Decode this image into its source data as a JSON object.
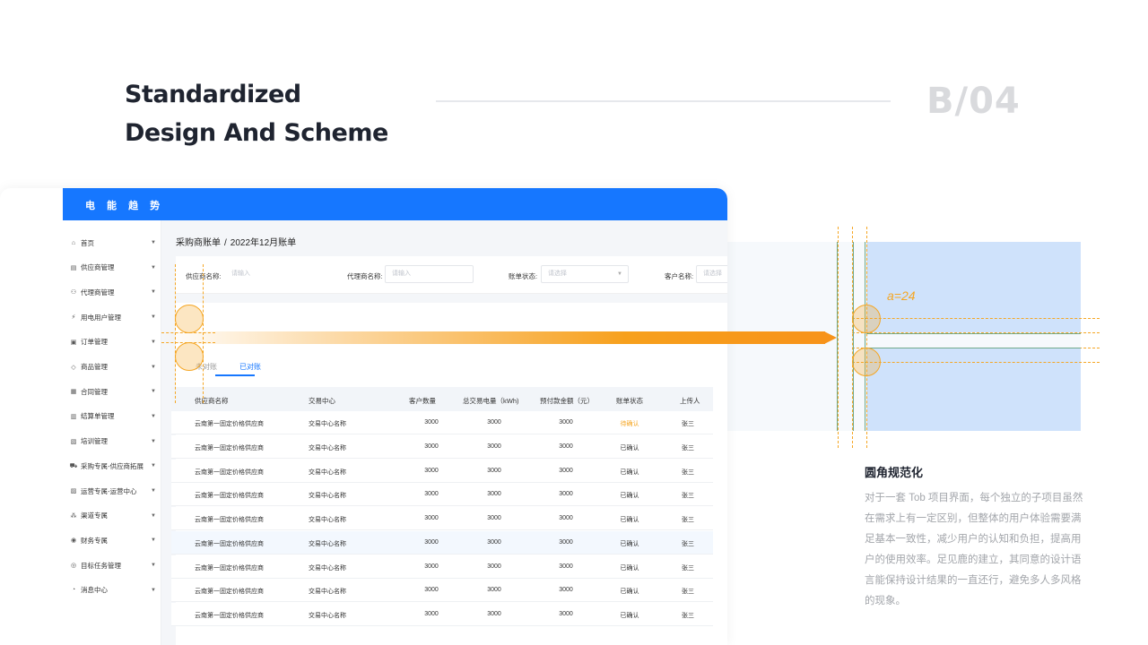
{
  "header": {
    "title_line1": "Standardized",
    "title_line2": "Design And Scheme",
    "page_code": "B/04"
  },
  "app": {
    "brand": "电 能 趋 势",
    "sidebar": {
      "items": [
        {
          "label": "首页",
          "icon": "home-icon"
        },
        {
          "label": "供应商管理",
          "icon": "building-icon"
        },
        {
          "label": "代理商管理",
          "icon": "user-icon"
        },
        {
          "label": "用电用户管理",
          "icon": "plug-icon"
        },
        {
          "label": "订单管理",
          "icon": "document-icon"
        },
        {
          "label": "商品管理",
          "icon": "tag-icon"
        },
        {
          "label": "合同管理",
          "icon": "contract-icon"
        },
        {
          "label": "结算单管理",
          "icon": "invoice-icon"
        },
        {
          "label": "培训管理",
          "icon": "training-icon"
        },
        {
          "label": "采购专属-供应商拓展",
          "icon": "cart-icon"
        },
        {
          "label": "运营专属-运营中心",
          "icon": "chart-icon"
        },
        {
          "label": "渠道专属",
          "icon": "network-icon"
        },
        {
          "label": "财务专属",
          "icon": "finance-icon"
        },
        {
          "label": "目标任务管理",
          "icon": "target-icon"
        },
        {
          "label": "消息中心",
          "icon": "bell-icon"
        }
      ]
    },
    "breadcrumb": {
      "parent": "采购商账单",
      "separator": "/",
      "current": "2022年12月账单"
    },
    "filters": {
      "supplier_label": "供应商名称:",
      "supplier_placeholder": "请输入",
      "agent_label": "代理商名称:",
      "agent_placeholder": "请输入",
      "status_label": "账单状态:",
      "status_placeholder": "请选择",
      "customer_label": "客户名称:",
      "customer_placeholder": "请选择"
    },
    "tabs": [
      {
        "label": "未对账",
        "active": false
      },
      {
        "label": "已对账",
        "active": true
      }
    ],
    "table": {
      "columns": [
        "供应商名称",
        "交易中心",
        "客户数量",
        "总交易电量（kWh)",
        "预付款金额（元）",
        "账单状态",
        "上传人"
      ],
      "rows": [
        [
          "云南第一固定价格供应商",
          "交易中心名称",
          "3000",
          "3000",
          "3000",
          "待确认",
          "张三"
        ],
        [
          "云南第一固定价格供应商",
          "交易中心名称",
          "3000",
          "3000",
          "3000",
          "已确认",
          "张三"
        ],
        [
          "云南第一固定价格供应商",
          "交易中心名称",
          "3000",
          "3000",
          "3000",
          "已确认",
          "张三"
        ],
        [
          "云南第一固定价格供应商",
          "交易中心名称",
          "3000",
          "3000",
          "3000",
          "已确认",
          "张三"
        ],
        [
          "云南第一固定价格供应商",
          "交易中心名称",
          "3000",
          "3000",
          "3000",
          "已确认",
          "张三"
        ],
        [
          "云南第一固定价格供应商",
          "交易中心名称",
          "3000",
          "3000",
          "3000",
          "已确认",
          "张三"
        ],
        [
          "云南第一固定价格供应商",
          "交易中心名称",
          "3000",
          "3000",
          "3000",
          "已确认",
          "张三"
        ],
        [
          "云南第一固定价格供应商",
          "交易中心名称",
          "3000",
          "3000",
          "3000",
          "已确认",
          "张三"
        ],
        [
          "云南第一固定价格供应商",
          "交易中心名称",
          "3000",
          "3000",
          "3000",
          "已确认",
          "张三"
        ]
      ]
    }
  },
  "illustration": {
    "radius_label": "a=24"
  },
  "description": {
    "title": "圆角规范化",
    "body": "对于一套 Tob 项目界面，每个独立的子项目虽然在需求上有一定区别，但整体的用户体验需要满足基本一致性，减少用户的认知和负担，提高用户的使用效率。足见鹿的建立，其同意的设计语言能保持设计结果的一直还行，避免多人多风格的现象。"
  },
  "colors": {
    "primary": "#1677ff",
    "accent": "#f5a623",
    "highlight_blue": "#cfe2fb"
  }
}
